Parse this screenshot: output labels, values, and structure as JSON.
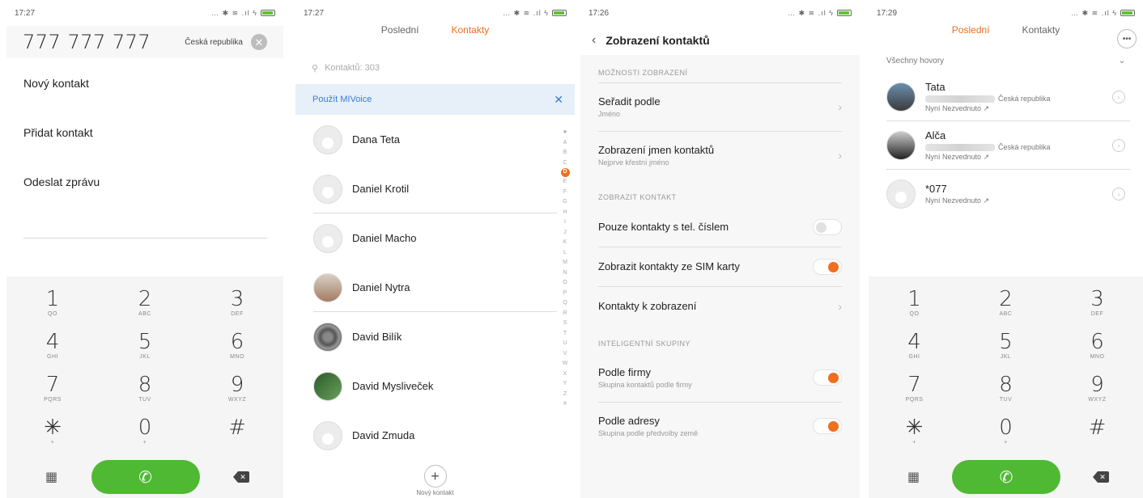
{
  "screens": {
    "dialer": {
      "time": "17:27",
      "number": "777 777 777",
      "country": "Česká republika",
      "actions": [
        "Nový kontakt",
        "Přidat kontakt",
        "Odeslat zprávu"
      ]
    },
    "contacts": {
      "time": "17:27",
      "tabs": [
        "Poslední",
        "Kontakty"
      ],
      "search_placeholder": "Kontaktů: 303",
      "banner": "Použít MIVoice",
      "contacts": [
        "Dana Teta",
        "Daniel Krotil",
        "Daniel Macho",
        "Daniel Nytra",
        "David Bilík",
        "David Mysliveček",
        "David Zmuda"
      ],
      "alpha_index": [
        "★",
        "A",
        "B",
        "C",
        "D",
        "E",
        "F",
        "G",
        "H",
        "I",
        "J",
        "K",
        "L",
        "M",
        "N",
        "O",
        "P",
        "Q",
        "R",
        "S",
        "T",
        "U",
        "V",
        "W",
        "X",
        "Y",
        "Z",
        "#"
      ],
      "new_contact_label": "Nový kontakt"
    },
    "settings": {
      "time": "17:26",
      "title": "Zobrazení kontaktů",
      "sections": {
        "display_options": "MOŽNOSTI ZOBRAZENÍ",
        "show_contacts": "ZOBRAZIT KONTAKT",
        "smart_groups": "INTELIGENTNÍ SKUPINY"
      },
      "sort_by": {
        "title": "Seřadit podle",
        "sub": "Jméno"
      },
      "name_display": {
        "title": "Zobrazení jmen kontaktů",
        "sub": "Nejprve křestní jméno"
      },
      "only_with_phone": {
        "title": "Pouze kontakty s tel. číslem",
        "on": false
      },
      "show_sim": {
        "title": "Zobrazit kontakty ze SIM karty",
        "on": true
      },
      "contacts_to_show": {
        "title": "Kontakty k zobrazení"
      },
      "by_company": {
        "title": "Podle firmy",
        "sub": "Skupina kontaktů podle firmy",
        "on": true
      },
      "by_address": {
        "title": "Podle adresy",
        "sub": "Skupina podle předvolby země",
        "on": true
      }
    },
    "recents": {
      "time": "17:29",
      "tabs": [
        "Poslední",
        "Kontakty"
      ],
      "filter": "Všechny hovory",
      "calls": [
        {
          "name": "Tata",
          "country": "Česká republika",
          "status": "Nyní Nezvednuto"
        },
        {
          "name": "Alča",
          "country": "Česká republika",
          "status": "Nyní Nezvednuto"
        },
        {
          "name": "*077",
          "country": "",
          "status": "Nyní Nezvednuto"
        }
      ]
    }
  },
  "keypad": [
    {
      "num": "1",
      "sub": "QO"
    },
    {
      "num": "2",
      "sub": "ABC"
    },
    {
      "num": "3",
      "sub": "DEF"
    },
    {
      "num": "4",
      "sub": "GHI"
    },
    {
      "num": "5",
      "sub": "JKL"
    },
    {
      "num": "6",
      "sub": "MNO"
    },
    {
      "num": "7",
      "sub": "PQRS"
    },
    {
      "num": "8",
      "sub": "TUV"
    },
    {
      "num": "9",
      "sub": "WXYZ"
    },
    {
      "num": "✳",
      "sub": "+"
    },
    {
      "num": "0",
      "sub": "+"
    },
    {
      "num": "#",
      "sub": ""
    }
  ],
  "colors": {
    "accent": "#f06e1d",
    "call_green": "#4fb934",
    "link_blue": "#3a7bd5"
  }
}
